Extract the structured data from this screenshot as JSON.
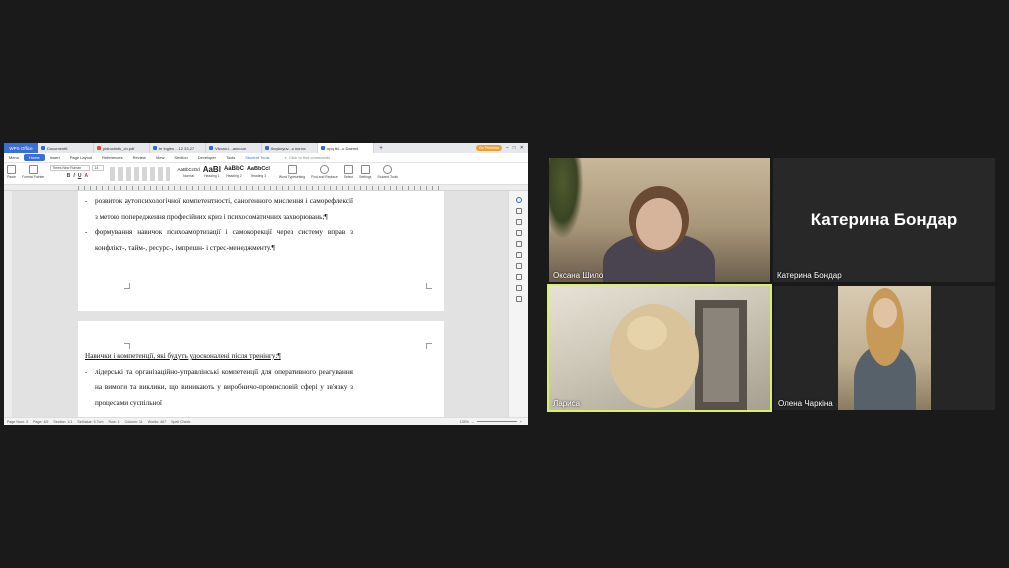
{
  "wps": {
    "app_tab": "WPS Office",
    "doc_tabs": [
      {
        "label": "Document6",
        "type": "doc"
      },
      {
        "label": "pidruchnik_ch.pdf",
        "type": "pdf"
      },
      {
        "label": "te Ingles ...12 33,27",
        "type": "doc"
      },
      {
        "label": "Vikcan-I...announ",
        "type": "doc"
      },
      {
        "label": "Ikvykoyuv...o nonnc",
        "type": "doc"
      },
      {
        "label": "npq tkl...u Daemit",
        "type": "doc"
      }
    ],
    "go_premium": "Go Premium",
    "menu": [
      "Menu",
      "Home",
      "Insert",
      "Page Layout",
      "References",
      "Review",
      "View",
      "Section",
      "Developer",
      "Tools",
      "Student Tools"
    ],
    "search_commands": "Click to find commands",
    "ribbon": {
      "paste": "Paste",
      "format_painter": "Format Painter",
      "font_name": "Times New Roman",
      "font_size": "14",
      "styles": [
        {
          "preview": "AaBbCcDd",
          "label": "Normal"
        },
        {
          "preview": "AaBl",
          "label": "Heading 1"
        },
        {
          "preview": "AaBbC",
          "label": "Heading 2"
        },
        {
          "preview": "AaBbCcl",
          "label": "Heading 3"
        }
      ],
      "word_typesetting": "Word Typesetting",
      "find_replace": "Find and Replace",
      "select": "Select",
      "settings": "Settings",
      "student_tools": "Student Tools"
    },
    "document": {
      "bullets_page1": [
        "розвиток аутопсихологічної компетентності, саногенного мислення і саморефлексії з метою попередження професійних криз і психосоматичних захворювань;¶",
        "формування навичок психоамортизації і самокорекції через систему вправ з конфлікт-, тайм-, ресурс-, імпрешн- і стрес-менеджменту.¶"
      ],
      "heading_page2": "Навички і компетенції, які будуть удосконалені після тренінгу:¶",
      "bullets_page2": [
        "лідерські та організаційно-управлінські компетенції для оперативного реагування на вимоги та виклики, що виникають у виробничо-промисловій сфері у зв'язку з процесами суспільної"
      ]
    },
    "status": {
      "page_num": "Page Num: 3",
      "page": "Page: 4/9",
      "section": "Section: 1/1",
      "setvalue": "SetValue: 5.7cm",
      "row": "Row: 1",
      "column": "Column: 11",
      "words": "Words: 467",
      "spell_check": "Spell Check",
      "zoom": "135%"
    }
  },
  "participants": [
    {
      "name": "Оксана Шило"
    },
    {
      "name": "Катерина Бондар",
      "display_name": "Катерина Бондар"
    },
    {
      "name": "Лариса"
    },
    {
      "name": "Олена Чаркіна"
    }
  ]
}
